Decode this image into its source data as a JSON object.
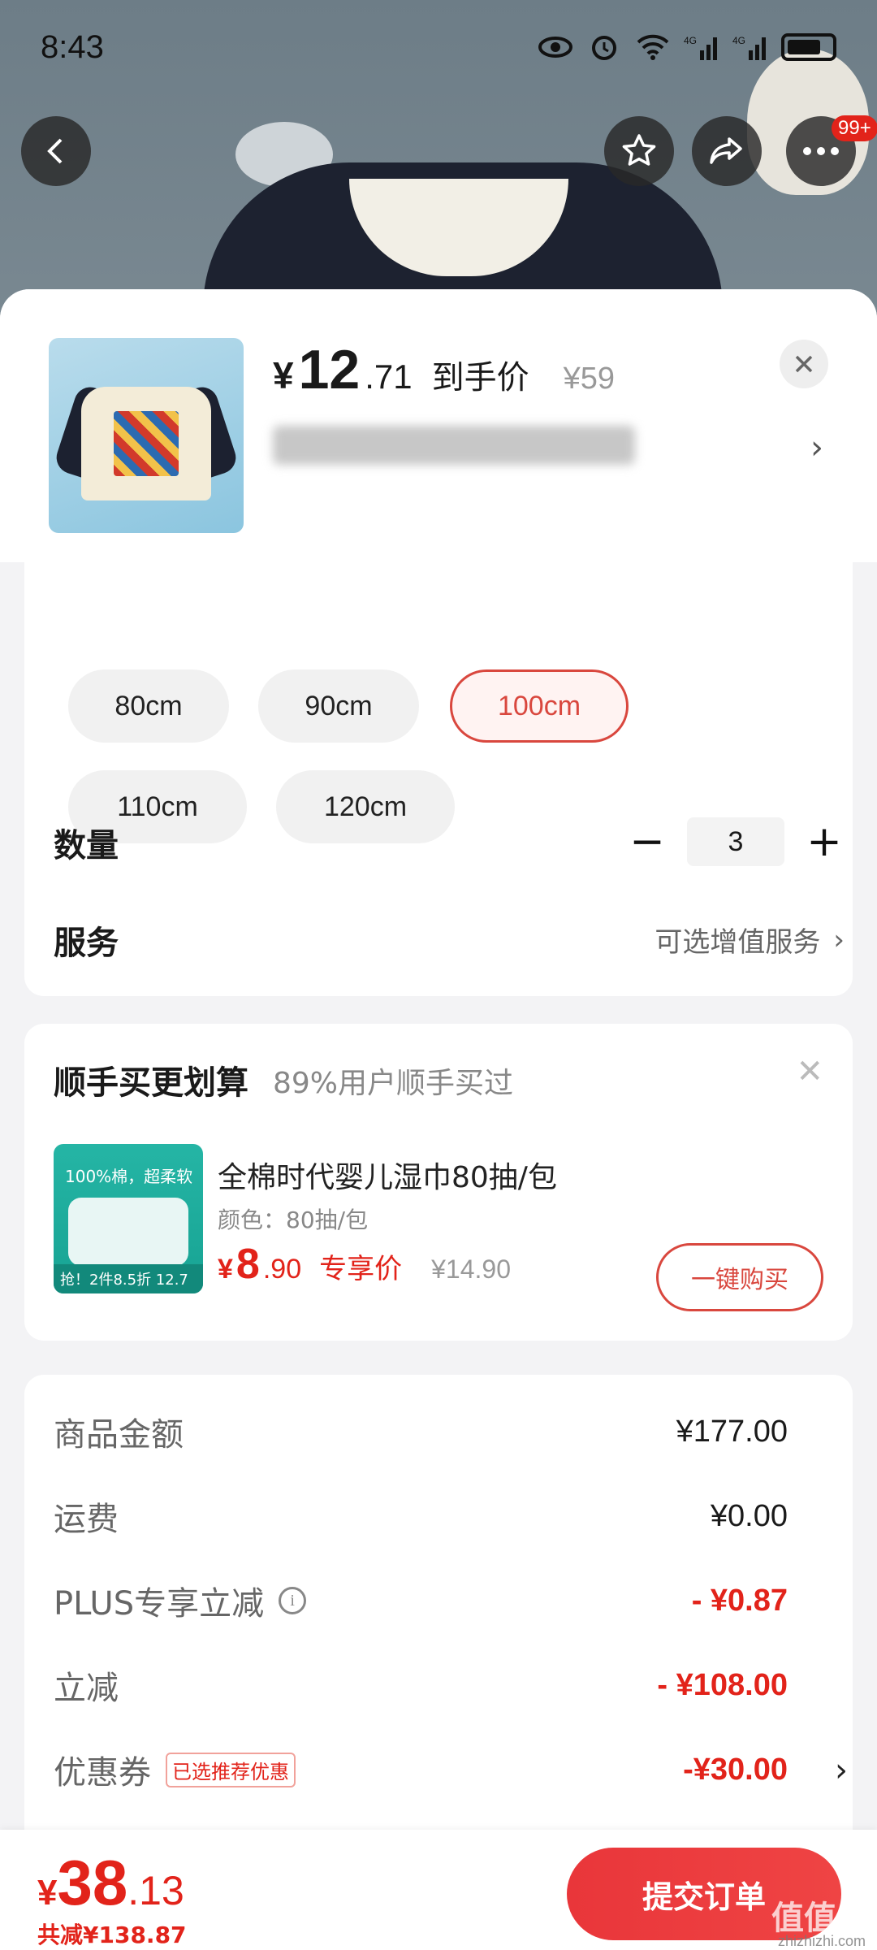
{
  "status_bar": {
    "time": "8:43"
  },
  "header": {
    "badge": "99+"
  },
  "product": {
    "price_currency": "¥",
    "price_int": "12",
    "price_dec": ".71",
    "price_label": "到手价",
    "original_price": "¥59"
  },
  "sizes": {
    "options": [
      "80cm",
      "90cm",
      "100cm",
      "110cm",
      "120cm"
    ],
    "selected": "100cm"
  },
  "quantity": {
    "label": "数量",
    "value": "3",
    "minus": "−",
    "plus": "+"
  },
  "service": {
    "label": "服务",
    "value": "可选增值服务"
  },
  "bundle": {
    "title": "顺手买更划算",
    "subtitle": "89%用户顺手买过",
    "item_name": "全棉时代婴儿湿巾80抽/包",
    "item_spec": "颜色：80抽/包",
    "price_currency": "¥",
    "price_int": "8",
    "price_dec": ".90",
    "price_label": "专享价",
    "original_price": "¥14.90",
    "buy_label": "一键购买",
    "image_top_text": "100%棉，超柔软",
    "image_tag": "抢！2件8.5折    12.7"
  },
  "summary": {
    "rows": [
      {
        "label": "商品金额",
        "value": "¥177.00"
      },
      {
        "label": "运费",
        "value": "¥0.00"
      },
      {
        "label": "PLUS专享立减",
        "value": "- ¥0.87"
      },
      {
        "label": "立减",
        "value": "- ¥108.00"
      },
      {
        "label": "优惠券",
        "tag": "已选推荐优惠",
        "value": "-¥30.00"
      }
    ]
  },
  "footer": {
    "total_currency": "¥",
    "total_int": "38",
    "total_dec": ".13",
    "saved": "共减¥138.87",
    "submit_label": "提交订单",
    "watermark": "值值值",
    "watermark_url": "zhizhizhi.com"
  },
  "colors": {
    "accent": "#e2231a",
    "selected_border": "#d9473e"
  }
}
